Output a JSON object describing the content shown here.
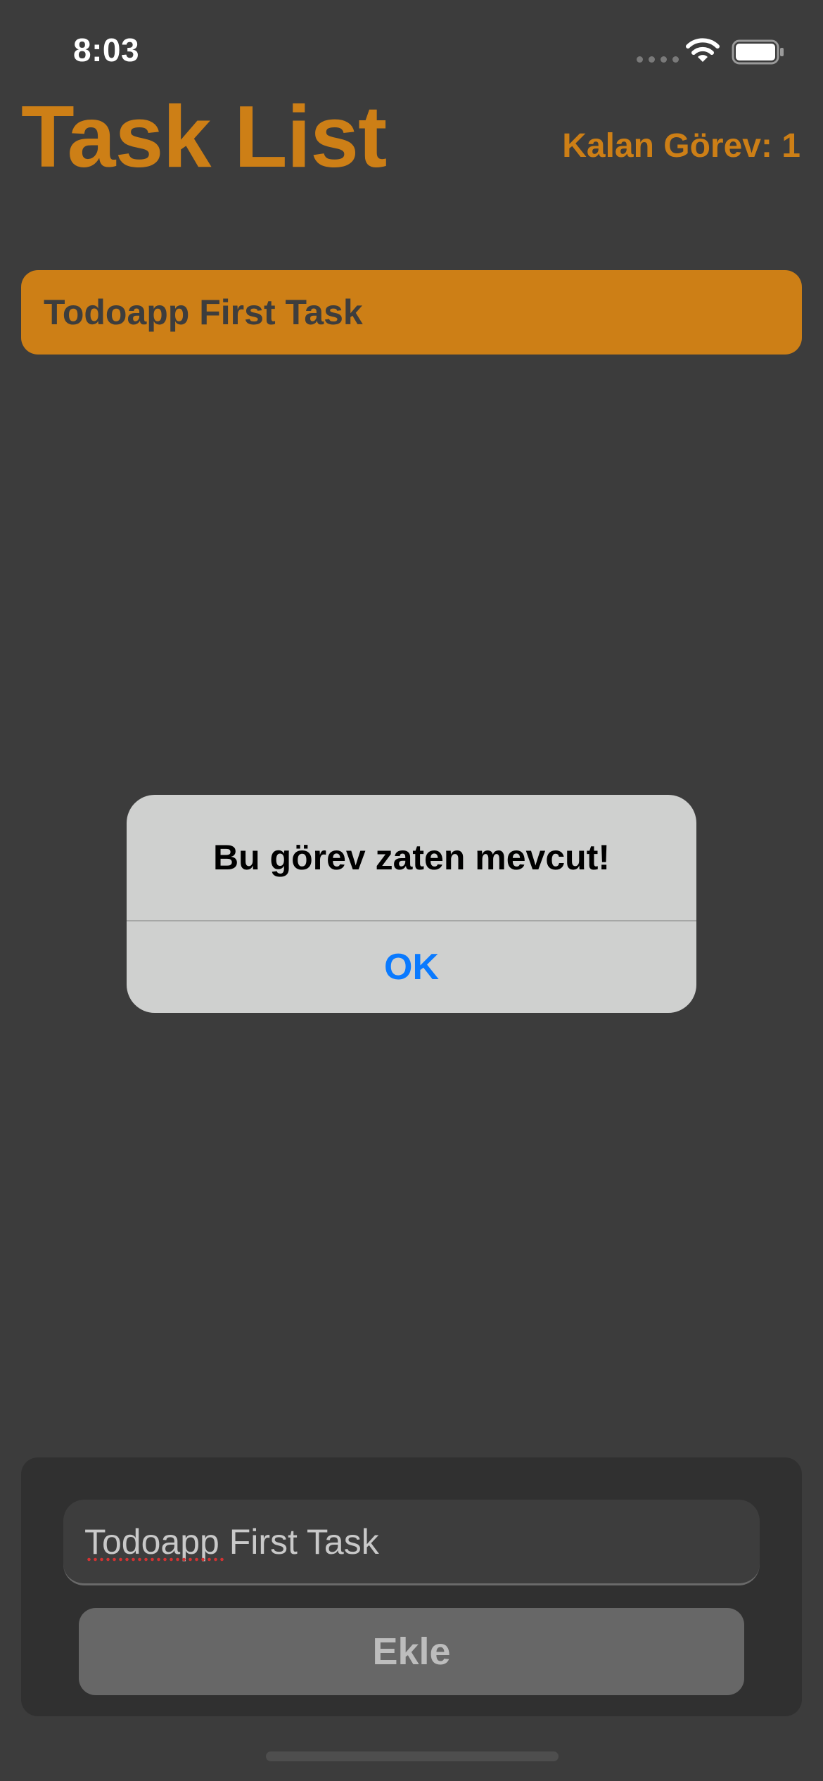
{
  "status_bar": {
    "time": "8:03",
    "icons": [
      "signal-icon",
      "wifi-icon",
      "battery-icon"
    ]
  },
  "header": {
    "title": "Task List",
    "remaining_label": "Kalan Görev: 1"
  },
  "tasks": [
    {
      "label": "Todoapp First Task"
    }
  ],
  "alert": {
    "message": "Bu görev zaten mevcut!",
    "ok_label": "OK"
  },
  "input_panel": {
    "input_value": "Todoapp First Task",
    "add_label": "Ekle"
  },
  "colors": {
    "background": "#3c3c3c",
    "accent": "#cd7f16",
    "alert_background": "#cfd0cf",
    "alert_button": "#0a7aff",
    "panel": "#303030",
    "add_button": "#676767"
  }
}
